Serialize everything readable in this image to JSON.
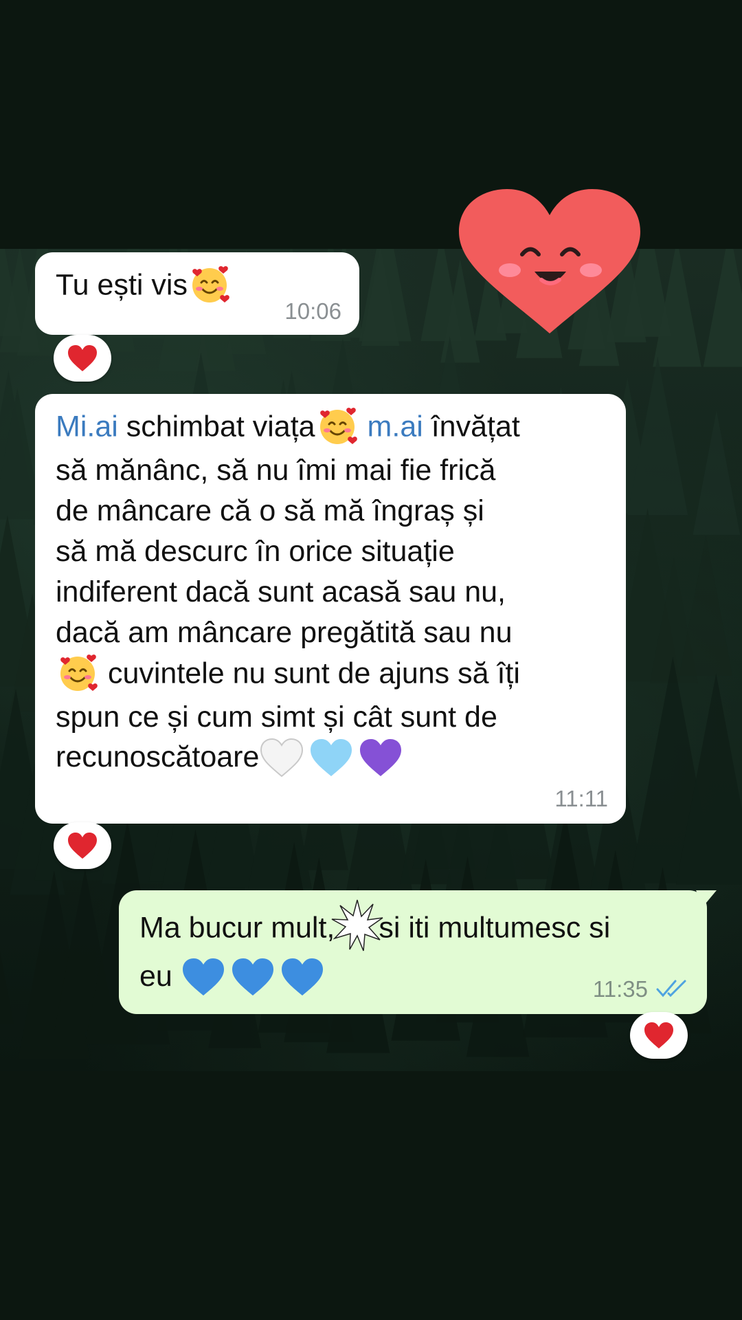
{
  "wallpaper": {
    "description_color": "#13241b"
  },
  "colors": {
    "incoming_bubble": "#ffffff",
    "outgoing_bubble": "#e2fbd4",
    "mention": "#3b7bbf",
    "read_ticks": "#4fa3e0",
    "reaction_heart": "#e0262f",
    "sticker_heart": "#f25c5c"
  },
  "messages": [
    {
      "direction": "incoming",
      "text": "Tu ești vis",
      "emoji": "smiling-face-with-hearts",
      "time": "10:06",
      "reaction": "red-heart"
    },
    {
      "direction": "incoming",
      "mention1": "Mi.ai",
      "part1": " schimbat viața",
      "mention2": "m.ai",
      "part2": " învățat",
      "line2": "să mănânc, să nu îmi mai fie frică",
      "line3": "de mâncare că o să mă îngraș și",
      "line4": "să mă descurc în orice situație",
      "line5": "indiferent dacă sunt acasă sau nu,",
      "line6": "dacă am mâncare pregătită sau nu",
      "line7": " cuvintele nu sunt de ajuns să îți",
      "line8": "spun ce și cum simt și cât sunt de",
      "line9": "recunoscătoare",
      "hearts": [
        "white-heart",
        "light-blue-heart",
        "purple-heart"
      ],
      "time": "11:11",
      "reaction": "red-heart"
    },
    {
      "direction": "outgoing",
      "part1": "Ma bucur mult,",
      "part2": "si iti multumesc si",
      "line2": "eu",
      "hearts": [
        "blue-heart",
        "blue-heart",
        "blue-heart"
      ],
      "time": "11:35",
      "status": "read",
      "reaction": "red-heart"
    }
  ],
  "sticker": {
    "name": "smiling-heart-sticker"
  }
}
